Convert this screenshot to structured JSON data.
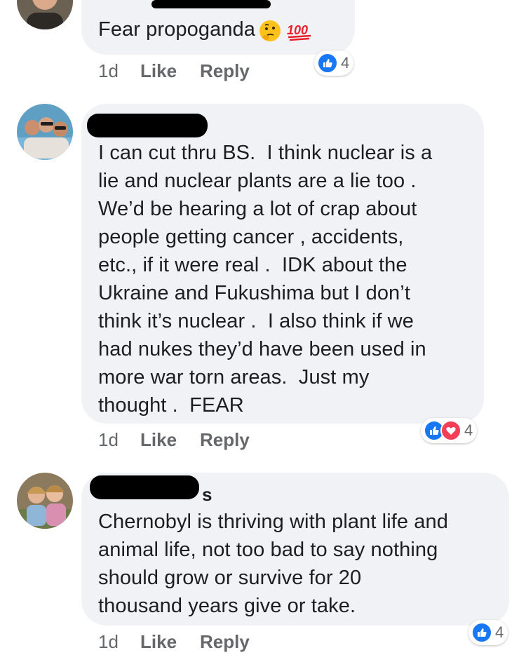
{
  "comments": [
    {
      "text": "Fear propoganda",
      "emojis": [
        "thinking-face-icon",
        "hundred-points-icon"
      ],
      "time": "1d",
      "like_label": "Like",
      "reply_label": "Reply",
      "reaction_count": "4",
      "reactions": [
        "like"
      ]
    },
    {
      "text": "I can cut thru BS.  I think nuclear is a\nlie and nuclear plants are a lie too .\nWe’d be hearing a lot of crap about\npeople getting cancer , accidents,\netc., if it were real .  IDK about the\nUkraine and Fukushima but I don’t\nthink it’s nuclear .  I also think if we\nhad nukes they’d have been used in\nmore war torn areas.  Just my\nthought .  FEAR",
      "time": "1d",
      "like_label": "Like",
      "reply_label": "Reply",
      "reaction_count": "4",
      "reactions": [
        "like",
        "love"
      ]
    },
    {
      "name_visible_fragment": "s",
      "text": "Chernobyl is thriving with plant life and\nanimal life, not too bad to say nothing\nshould grow or survive for 20\nthousand years give or take.",
      "time": "1d",
      "like_label": "Like",
      "reply_label": "Reply",
      "reaction_count": "4",
      "reactions": [
        "like"
      ]
    }
  ],
  "colors": {
    "bubble": "#f0f2f5",
    "like_blue": "#1877f2",
    "love_red": "#f33e58",
    "meta_gray": "#65676b"
  }
}
